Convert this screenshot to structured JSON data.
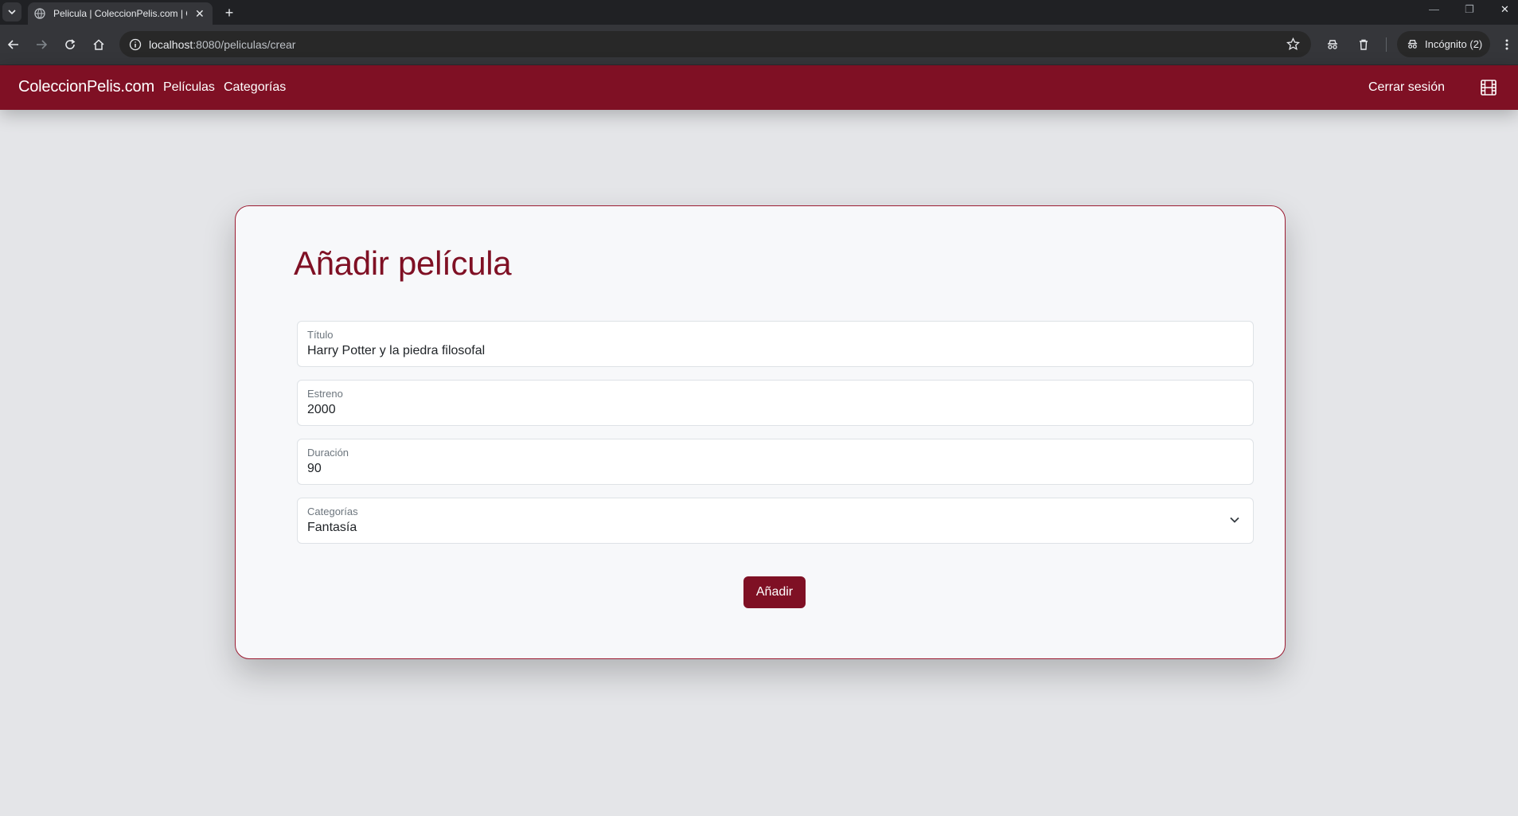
{
  "browser": {
    "tab_title": "Pelicula | ColeccionPelis.com | C",
    "url_host": "localhost",
    "url_path": ":8080/peliculas/crear",
    "incognito_label": "Incógnito (2)"
  },
  "nav": {
    "brand": "ColeccionPelis.com",
    "links": [
      "Películas",
      "Categorías"
    ],
    "logout": "Cerrar sesión"
  },
  "form": {
    "title": "Añadir película",
    "fields": [
      {
        "label": "Título",
        "value": "Harry Potter y la piedra filosofal"
      },
      {
        "label": "Estreno",
        "value": "2000"
      },
      {
        "label": "Duración",
        "value": "90"
      },
      {
        "label": "Categorías",
        "value": "Fantasía"
      }
    ],
    "submit_label": "Añadir"
  },
  "colors": {
    "brand": "#7f1024",
    "page_bg": "#e4e5e8",
    "card_bg": "#f7f8fa"
  }
}
